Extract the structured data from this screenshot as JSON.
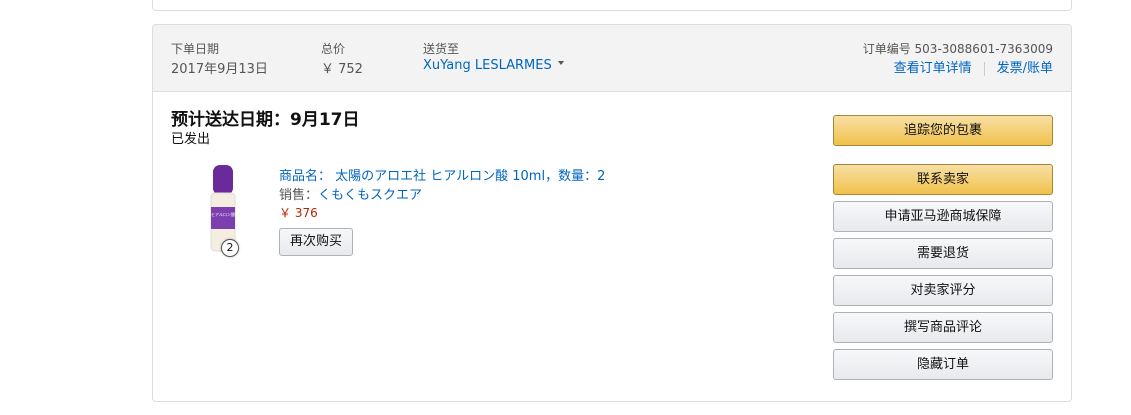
{
  "order": {
    "header": {
      "date_label": "下单日期",
      "date_value": "2017年9月13日",
      "total_label": "总价",
      "total_value": "￥ 752",
      "ship_to_label": "送货至",
      "ship_to_value": "XuYang LESLARMES",
      "order_number": "订单编号 503-3088601-7363009",
      "details_link": "查看订单详情",
      "invoice_link": "发票/账单"
    },
    "shipment": {
      "title": "预计送达日期：9月17日",
      "status": "已发出"
    },
    "item": {
      "title": "商品名： 太陽のアロエ社 ヒアルロン酸 10ml，数量：2",
      "seller_label": "销售：",
      "seller_name": "くもくもスクエア",
      "price": "￥ 376",
      "quantity_badge": "2",
      "rebuy_button": "再次购买",
      "image_text": "ヒアルロン酸"
    },
    "actions": [
      "追踪您的包裹",
      "联系卖家",
      "申请亚马逊商城保障",
      "需要退货",
      "对卖家评分",
      "撰写商品评论",
      "隐藏订单"
    ],
    "colors": {
      "link": "#0066c0",
      "price": "#b12704",
      "primary_button": "#f0c14b",
      "header_bg": "#f3f3f3"
    }
  }
}
